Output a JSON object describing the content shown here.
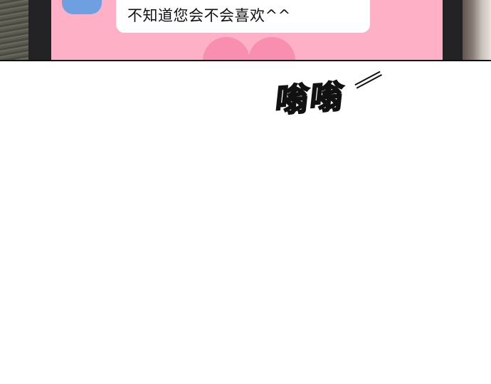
{
  "chat": {
    "message": "不知道您会不会喜欢^^"
  },
  "sound_effect": {
    "text": "嗡嗡",
    "trail": "—"
  },
  "colors": {
    "screen_pink": "#fdb0c6",
    "heart_pink": "#f98fb0",
    "avatar_blue": "#6e9fe0",
    "bubble_white": "#ffffff",
    "phone_frame": "#232325"
  }
}
